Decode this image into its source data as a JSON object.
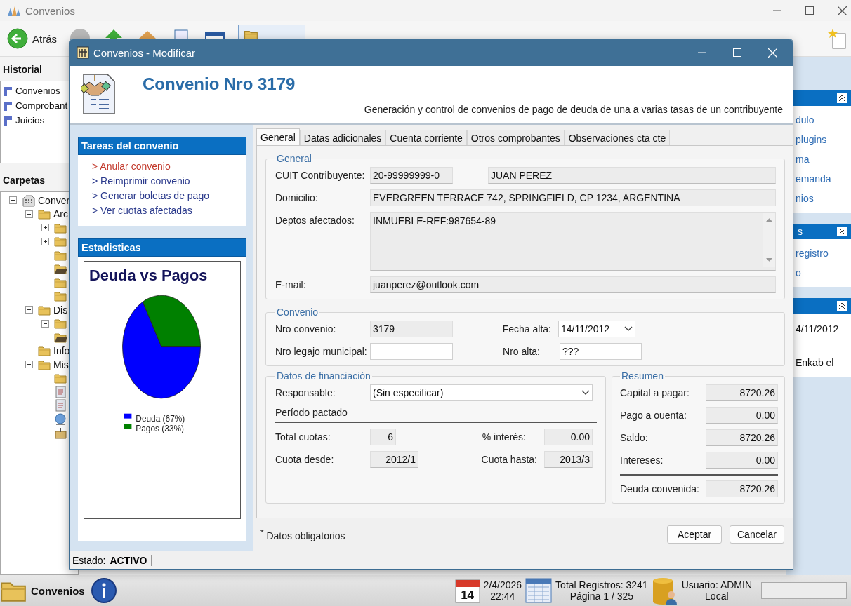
{
  "app": {
    "title": "Convenios",
    "back_label": "Atrás"
  },
  "historial": {
    "title": "Historial",
    "items": [
      "Convenios",
      "Comprobant",
      "Juicios"
    ]
  },
  "carpetas": {
    "title": "Carpetas",
    "tree": [
      {
        "label": "Conver",
        "kind": "app",
        "expanded": true,
        "children": [
          {
            "label": "Arc",
            "kind": "folder",
            "expanded": true,
            "children": [
              {
                "kind": "folder",
                "expanded": false
              },
              {
                "kind": "folder",
                "expanded": false
              },
              {
                "kind": "folder"
              },
              {
                "kind": "folder-open"
              },
              {
                "kind": "folder"
              },
              {
                "kind": "folder"
              }
            ]
          },
          {
            "label": "Dis",
            "kind": "folder",
            "expanded": true,
            "children": [
              {
                "kind": "folder",
                "expanded": true
              },
              {
                "kind": "folder-open"
              }
            ]
          },
          {
            "label": "Info",
            "kind": "folder"
          },
          {
            "label": "Mis",
            "kind": "folder",
            "expanded": true,
            "children": [
              {
                "kind": "folder"
              },
              {
                "kind": "document"
              },
              {
                "kind": "document"
              },
              {
                "kind": "globe"
              },
              {
                "kind": "package"
              }
            ]
          }
        ]
      }
    ]
  },
  "side_panels": [
    {
      "items": [
        "dulo",
        "plugins",
        "ma",
        "emanda",
        "nios"
      ]
    },
    {
      "title": "s",
      "items": [
        "registro",
        "o"
      ]
    },
    {
      "items": [
        "4/11/2012",
        "Enkab el"
      ]
    }
  ],
  "status_bar": {
    "module": "Convenios",
    "calendar_day": "14",
    "date": "2/4/2026",
    "time": "22:44",
    "records": "Total Registros: 3241",
    "page": "Página 1 / 325",
    "user": "Usuario: ADMIN",
    "location": "Local"
  },
  "dialog": {
    "title": "Convenios - Modificar",
    "heading": "Convenio Nro 3179",
    "description": "Generación y control de convenios de pago de deuda de una a varias tasas de un contribuyente",
    "tasks": {
      "title": "Tareas del convenio",
      "items": [
        {
          "label": "> Anular convenio",
          "kind": "danger"
        },
        {
          "label": "> Reimprimir convenio",
          "kind": "normal"
        },
        {
          "label": "> Generar boletas de pago",
          "kind": "normal"
        },
        {
          "label": "> Ver cuotas afectadas",
          "kind": "normal"
        }
      ]
    },
    "stats": {
      "title": "Estadisticas",
      "chart_data": {
        "type": "pie",
        "title": "Deuda vs Pagos",
        "categories": [
          "Deuda (67%)",
          "Pagos (33%)"
        ],
        "values": [
          67,
          33
        ],
        "colors": [
          "#0000ff",
          "#008000"
        ],
        "legend": "bottom"
      }
    },
    "tabs": [
      {
        "label": "General",
        "selected": true
      },
      {
        "label": "Datas adicionales",
        "selected": false
      },
      {
        "label": "Cuenta corriente",
        "selected": false
      },
      {
        "label": "Otros comprobantes",
        "selected": false
      },
      {
        "label": "Observaciones cta cte",
        "selected": false
      }
    ],
    "general": {
      "title": "General",
      "cuit": {
        "label": "CUIT Contribuyente:",
        "value": "20-99999999-0",
        "readonly": true
      },
      "name": {
        "value": "JUAN PEREZ",
        "readonly": true
      },
      "address": {
        "label": "Domicilio:",
        "value": "EVERGREEN TERRACE 742, SPRINGFIELD, CP 1234, ARGENTINA",
        "readonly": true
      },
      "departments": {
        "label": "Deptos afectados:",
        "value": "INMUEBLE-REF:987654-89",
        "readonly": true
      },
      "email": {
        "label": "E-mail:",
        "value": "juanperez@outlook.com",
        "readonly": true
      }
    },
    "convenio": {
      "title": "Convenio",
      "number": {
        "label": "Nro convenio:",
        "value": "3179",
        "readonly": true
      },
      "date": {
        "label": "Fecha alta:",
        "value": "14/11/2012",
        "readonly": false
      },
      "file_number": {
        "label": "Nro legajo municipal:",
        "readonly": false
      },
      "alta_number": {
        "label": "Nro alta:",
        "value": "???",
        "readonly": false
      }
    },
    "financing": {
      "title": "Datos de financiación",
      "responsible": {
        "label": "Responsable:",
        "value": "(Sin especificar)",
        "readonly": false
      },
      "period_title": "Período pactado",
      "total": {
        "label": "Total cuotas:",
        "value": "6",
        "readonly": true
      },
      "interest": {
        "label": "% interés:",
        "value": "0.00",
        "readonly": true
      },
      "from": {
        "label": "Cuota desde:",
        "value": "2012/1",
        "readonly": true
      },
      "to": {
        "label": "Cuota hasta:",
        "value": "2013/3",
        "readonly": true
      }
    },
    "summary": {
      "title": "Resumen",
      "rows": [
        {
          "label": "Capital a pagar:",
          "value": "8720.26",
          "kind": "line"
        },
        {
          "label": "Pago a ouenta:",
          "value": "0.00",
          "kind": "line"
        },
        {
          "label": "Saldo:",
          "value": "8720.26",
          "kind": "line"
        },
        {
          "label": "Intereses:",
          "value": "0.00",
          "kind": "line"
        },
        {
          "label": "Deuda convenida:",
          "value": "8720.26",
          "kind": "total"
        }
      ]
    },
    "required_note": "$^{*}$ Datos obligatorios",
    "buttons": [
      "Aceptar",
      "Cancelar"
    ],
    "status": {
      "label": "Estado:",
      "value": "ACTIVO"
    }
  }
}
